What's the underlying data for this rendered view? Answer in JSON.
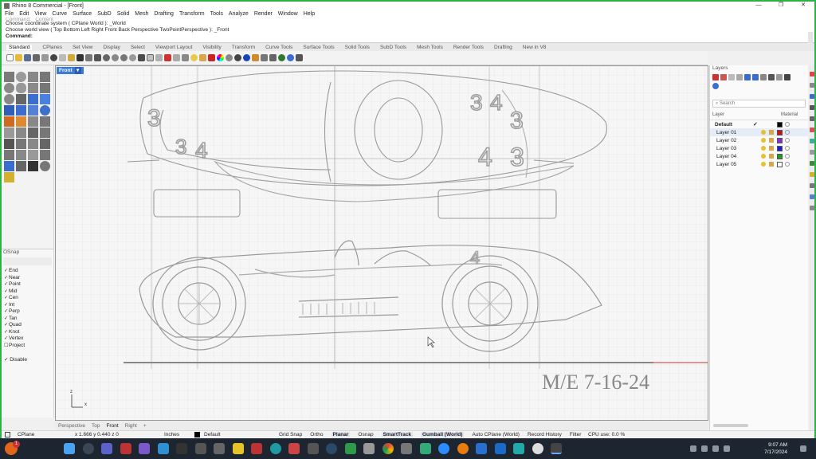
{
  "window": {
    "title": "Rhino 8 Commercial - [Front]",
    "controls": [
      "—",
      "❐",
      "✕"
    ]
  },
  "menu": [
    "File",
    "Edit",
    "View",
    "Curve",
    "Surface",
    "SubD",
    "Solid",
    "Mesh",
    "Drafting",
    "Transform",
    "Tools",
    "Analyze",
    "Render",
    "Window",
    "Help"
  ],
  "command_history": {
    "line_cut": "Command: _Content",
    "line1": "Choose coordinate system ( CPlane  World ): _World",
    "line2": "Choose world view ( Top  Bottom  Left  Right  Front  Back  Perspective  TwoPointPerspective ): _Front",
    "prompt": "Command:"
  },
  "toolbar_tabs": [
    "Standard",
    "CPlanes",
    "Set View",
    "Display",
    "Select",
    "Viewport Layout",
    "Visibility",
    "Transform",
    "Curve Tools",
    "Surface Tools",
    "Solid Tools",
    "SubD Tools",
    "Mesh Tools",
    "Render Tools",
    "Drafting",
    "New in V8"
  ],
  "viewport": {
    "name": "Front",
    "signature": "M/E  7-16-24",
    "axis_z": "z",
    "axis_x": "x",
    "sketch_numbers": [
      "3",
      "3",
      "4",
      "3",
      "4",
      "3",
      "4",
      "3",
      "4"
    ]
  },
  "viewport_tabs": [
    "Perspective",
    "Top",
    "Front",
    "Right",
    "+"
  ],
  "osnap": {
    "title": "OSnap",
    "items": [
      {
        "label": "End",
        "checked": true
      },
      {
        "label": "Near",
        "checked": true
      },
      {
        "label": "Point",
        "checked": true
      },
      {
        "label": "Mid",
        "checked": true
      },
      {
        "label": "Cen",
        "checked": true
      },
      {
        "label": "Int",
        "checked": true
      },
      {
        "label": "Perp",
        "checked": true
      },
      {
        "label": "Tan",
        "checked": true
      },
      {
        "label": "Quad",
        "checked": true
      },
      {
        "label": "Knot",
        "checked": true
      },
      {
        "label": "Vertex",
        "checked": true
      },
      {
        "label": "Project",
        "checked": false
      }
    ],
    "disable": "Disable"
  },
  "layers_panel": {
    "title": "Layers",
    "search_placeholder": "Search",
    "col_layer": "Layer",
    "col_material": "Material",
    "layers": [
      {
        "name": "Default",
        "color": "#000000",
        "current": true
      },
      {
        "name": "Layer 01",
        "color": "#d01010",
        "current": false
      },
      {
        "name": "Layer 02",
        "color": "#8a2be2",
        "current": false
      },
      {
        "name": "Layer 03",
        "color": "#1a1ae0",
        "current": false
      },
      {
        "name": "Layer 04",
        "color": "#1aa01a",
        "current": false
      },
      {
        "name": "Layer 05",
        "color": "#ffffff",
        "current": false
      }
    ]
  },
  "status": {
    "cplane": "CPlane",
    "coords": "x 1.666  y 0.440  z 0",
    "units": "Inches",
    "layer": "Default",
    "toggles": [
      {
        "label": "Grid Snap",
        "on": false
      },
      {
        "label": "Ortho",
        "on": false
      },
      {
        "label": "Planar",
        "on": true
      },
      {
        "label": "Osnap",
        "on": false
      },
      {
        "label": "SmartTrack",
        "on": true
      },
      {
        "label": "Gumball (World)",
        "on": true
      },
      {
        "label": "Auto CPlane (World)",
        "on": false
      },
      {
        "label": "Record History",
        "on": false
      },
      {
        "label": "Filter",
        "on": false
      }
    ],
    "cpu": "CPU use: 0.0 %"
  },
  "taskbar": {
    "time": "9:07 AM",
    "date": "7/17/2024",
    "badge": "1"
  },
  "colors": {
    "accent": "#3b7bd4",
    "taskbar": "#1c2530",
    "border_green": "#2bb34a"
  }
}
